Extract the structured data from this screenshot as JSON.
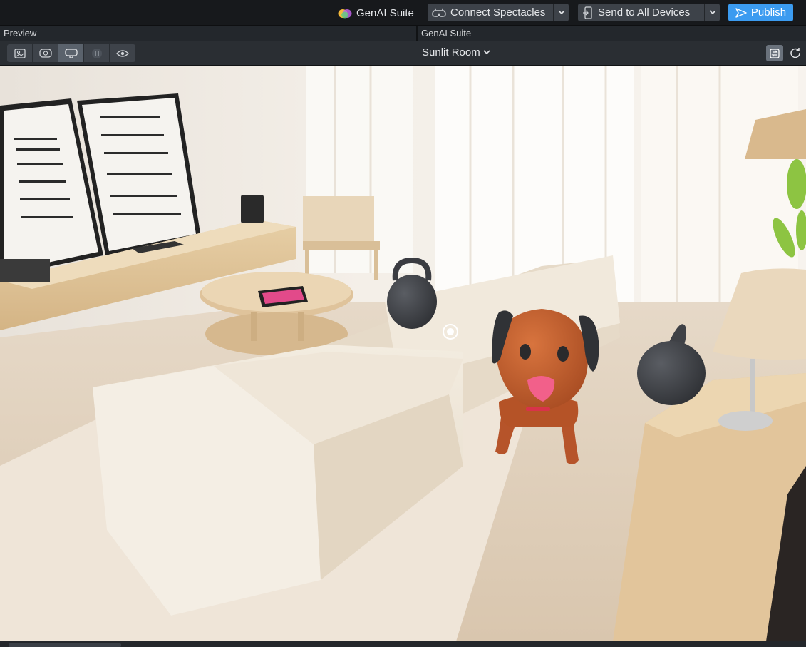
{
  "topbar": {
    "brand": "GenAI Suite",
    "connect_label": "Connect Spectacles",
    "send_label": "Send to All Devices",
    "publish_label": "Publish"
  },
  "panels": {
    "left_title": "Preview",
    "right_title": "GenAI Suite"
  },
  "toolbar": {
    "room": "Sunlit Room",
    "tools": [
      "image-icon",
      "camera-view-icon",
      "device-icon",
      "pause-icon",
      "eye-icon"
    ],
    "active_tool_index": 2
  },
  "colors": {
    "publish": "#3b9bf0",
    "dog_body": "#c9602f",
    "dog_nose": "#f2608a",
    "kettlebell": "#3f4146"
  }
}
